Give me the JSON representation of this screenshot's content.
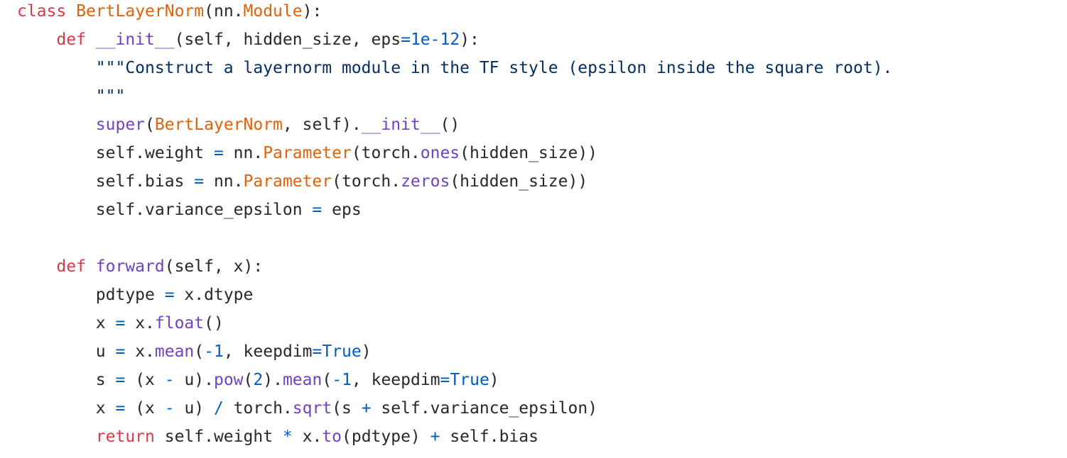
{
  "theme": {
    "background": "#ffffff",
    "plain": "#24292e",
    "keyword": "#d73a49",
    "class": "#e36209",
    "func": "#6f42c1",
    "number": "#005cc5",
    "string": "#032f62",
    "op": "#005cc5",
    "magic": "#6f42c1"
  },
  "code_lines": [
    [
      [
        "keyword",
        "class"
      ],
      [
        "plain",
        " "
      ],
      [
        "class",
        "BertLayerNorm"
      ],
      [
        "plain",
        "(nn."
      ],
      [
        "class",
        "Module"
      ],
      [
        "plain",
        "):"
      ]
    ],
    [
      [
        "plain",
        "    "
      ],
      [
        "keyword",
        "def"
      ],
      [
        "plain",
        " "
      ],
      [
        "magic",
        "__init__"
      ],
      [
        "plain",
        "(self, hidden_size, eps"
      ],
      [
        "op",
        "="
      ],
      [
        "number",
        "1e-12"
      ],
      [
        "plain",
        "):"
      ]
    ],
    [
      [
        "plain",
        "        "
      ],
      [
        "string",
        "\"\"\"Construct a layernorm module in the TF style (epsilon inside the square root)."
      ]
    ],
    [
      [
        "plain",
        "        "
      ],
      [
        "string",
        "\"\"\""
      ]
    ],
    [
      [
        "plain",
        "        "
      ],
      [
        "func",
        "super"
      ],
      [
        "plain",
        "("
      ],
      [
        "class",
        "BertLayerNorm"
      ],
      [
        "plain",
        ", self)."
      ],
      [
        "magic",
        "__init__"
      ],
      [
        "plain",
        "()"
      ]
    ],
    [
      [
        "plain",
        "        self.weight "
      ],
      [
        "op",
        "="
      ],
      [
        "plain",
        " nn."
      ],
      [
        "class",
        "Parameter"
      ],
      [
        "plain",
        "(torch."
      ],
      [
        "func",
        "ones"
      ],
      [
        "plain",
        "(hidden_size))"
      ]
    ],
    [
      [
        "plain",
        "        self.bias "
      ],
      [
        "op",
        "="
      ],
      [
        "plain",
        " nn."
      ],
      [
        "class",
        "Parameter"
      ],
      [
        "plain",
        "(torch."
      ],
      [
        "func",
        "zeros"
      ],
      [
        "plain",
        "(hidden_size))"
      ]
    ],
    [
      [
        "plain",
        "        self.variance_epsilon "
      ],
      [
        "op",
        "="
      ],
      [
        "plain",
        " eps"
      ]
    ],
    [],
    [
      [
        "plain",
        "    "
      ],
      [
        "keyword",
        "def"
      ],
      [
        "plain",
        " "
      ],
      [
        "func",
        "forward"
      ],
      [
        "plain",
        "(self, x):"
      ]
    ],
    [
      [
        "plain",
        "        pdtype "
      ],
      [
        "op",
        "="
      ],
      [
        "plain",
        " x.dtype"
      ]
    ],
    [
      [
        "plain",
        "        x "
      ],
      [
        "op",
        "="
      ],
      [
        "plain",
        " x."
      ],
      [
        "func",
        "float"
      ],
      [
        "plain",
        "()"
      ]
    ],
    [
      [
        "plain",
        "        u "
      ],
      [
        "op",
        "="
      ],
      [
        "plain",
        " x."
      ],
      [
        "func",
        "mean"
      ],
      [
        "plain",
        "("
      ],
      [
        "op",
        "-"
      ],
      [
        "number",
        "1"
      ],
      [
        "plain",
        ", keepdim"
      ],
      [
        "op",
        "="
      ],
      [
        "number",
        "True"
      ],
      [
        "plain",
        ")"
      ]
    ],
    [
      [
        "plain",
        "        s "
      ],
      [
        "op",
        "="
      ],
      [
        "plain",
        " (x "
      ],
      [
        "op",
        "-"
      ],
      [
        "plain",
        " u)."
      ],
      [
        "func",
        "pow"
      ],
      [
        "plain",
        "("
      ],
      [
        "number",
        "2"
      ],
      [
        "plain",
        ")."
      ],
      [
        "func",
        "mean"
      ],
      [
        "plain",
        "("
      ],
      [
        "op",
        "-"
      ],
      [
        "number",
        "1"
      ],
      [
        "plain",
        ", keepdim"
      ],
      [
        "op",
        "="
      ],
      [
        "number",
        "True"
      ],
      [
        "plain",
        ")"
      ]
    ],
    [
      [
        "plain",
        "        x "
      ],
      [
        "op",
        "="
      ],
      [
        "plain",
        " (x "
      ],
      [
        "op",
        "-"
      ],
      [
        "plain",
        " u) "
      ],
      [
        "op",
        "/"
      ],
      [
        "plain",
        " torch."
      ],
      [
        "func",
        "sqrt"
      ],
      [
        "plain",
        "(s "
      ],
      [
        "op",
        "+"
      ],
      [
        "plain",
        " self.variance_epsilon)"
      ]
    ],
    [
      [
        "plain",
        "        "
      ],
      [
        "keyword",
        "return"
      ],
      [
        "plain",
        " self.weight "
      ],
      [
        "op",
        "*"
      ],
      [
        "plain",
        " x."
      ],
      [
        "func",
        "to"
      ],
      [
        "plain",
        "(pdtype) "
      ],
      [
        "op",
        "+"
      ],
      [
        "plain",
        " self.bias"
      ]
    ]
  ]
}
